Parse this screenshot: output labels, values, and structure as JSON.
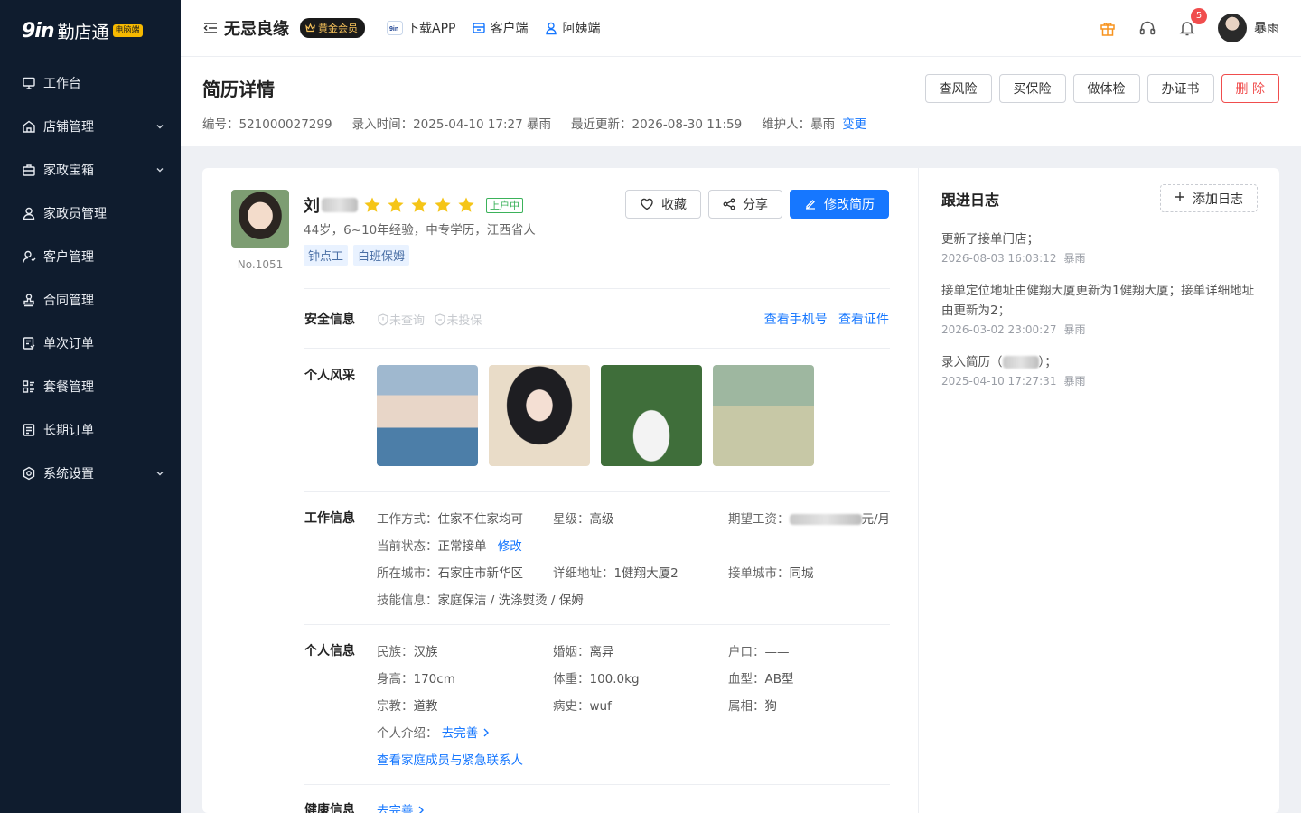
{
  "brand": {
    "mark": "9in",
    "name": "勤店通",
    "badge": "电脑端"
  },
  "sidebar": {
    "items": [
      {
        "label": "工作台",
        "icon": "monitor-icon",
        "expandable": false
      },
      {
        "label": "店铺管理",
        "icon": "store-icon",
        "expandable": true
      },
      {
        "label": "家政宝箱",
        "icon": "toolbox-icon",
        "expandable": true
      },
      {
        "label": "家政员管理",
        "icon": "worker-icon",
        "expandable": false
      },
      {
        "label": "客户管理",
        "icon": "customer-icon",
        "expandable": false
      },
      {
        "label": "合同管理",
        "icon": "stamp-icon",
        "expandable": false
      },
      {
        "label": "单次订单",
        "icon": "order-icon",
        "expandable": false
      },
      {
        "label": "套餐管理",
        "icon": "package-icon",
        "expandable": false
      },
      {
        "label": "长期订单",
        "icon": "long-order-icon",
        "expandable": false
      },
      {
        "label": "系统设置",
        "icon": "settings-icon",
        "expandable": true
      }
    ]
  },
  "header": {
    "shop_name": "无忌良缘",
    "member_badge": "黄金会员",
    "links": [
      {
        "label": "下载APP",
        "icon": "app-icon"
      },
      {
        "label": "客户端",
        "icon": "client-icon"
      },
      {
        "label": "阿姨端",
        "icon": "nanny-icon"
      }
    ],
    "notification_count": "5",
    "user_name": "暴雨"
  },
  "titlebar": {
    "title": "简历详情",
    "id_label": "编号：",
    "id_value": "521000027299",
    "entry_label": "录入时间：",
    "entry_value": "2025-04-10 17:27 暴雨",
    "updated_label": "最近更新：",
    "updated_value": "2026-08-30 11:59",
    "maintainer_label": "维护人：",
    "maintainer_value": "暴雨",
    "change_link": "变更",
    "actions": [
      "查风险",
      "买保险",
      "做体检",
      "办证书",
      "删 除"
    ]
  },
  "profile": {
    "surname": "刘",
    "stars": 5,
    "status": "上户中",
    "summary": "44岁，6~10年经验，中专学历，江西省人",
    "tags": [
      "钟点工",
      "白班保姆"
    ],
    "number": "No.1051",
    "actions": {
      "favorite": "收藏",
      "share": "分享",
      "edit": "修改简历"
    }
  },
  "safety": {
    "label": "安全信息",
    "not_checked": "未查询",
    "not_insured": "未投保",
    "view_phone": "查看手机号",
    "view_cert": "查看证件"
  },
  "gallery": {
    "label": "个人风采"
  },
  "work": {
    "label": "工作信息",
    "mode_label": "工作方式：",
    "mode_value": "住家不住家均可",
    "level_label": "星级：",
    "level_value": "高级",
    "salary_label": "期望工资：",
    "salary_suffix": "元/月",
    "state_label": "当前状态：",
    "state_value": "正常接单",
    "state_edit": "修改",
    "city_label": "所在城市：",
    "city_value": "石家庄市新华区",
    "address_label": "详细地址：",
    "address_value": "1健翔大厦2",
    "order_city_label": "接单城市：",
    "order_city_value": "同城",
    "skills_label": "技能信息：",
    "skills_value": "家庭保洁 / 洗涤熨烫 / 保姆"
  },
  "personal": {
    "label": "个人信息",
    "ethnicity_label": "民族：",
    "ethnicity_value": "汉族",
    "marriage_label": "婚姻：",
    "marriage_value": "离异",
    "hukou_label": "户口：",
    "hukou_value": "——",
    "height_label": "身高：",
    "height_value": "170cm",
    "weight_label": "体重：",
    "weight_value": "100.0kg",
    "blood_label": "血型：",
    "blood_value": "AB型",
    "religion_label": "宗教：",
    "religion_value": "道教",
    "illness_label": "病史：",
    "illness_value": "wuf",
    "zodiac_label": "属相：",
    "zodiac_value": "狗",
    "intro_label": "个人介绍：",
    "intro_link": "去完善",
    "family_link": "查看家庭成员与紧急联系人"
  },
  "health": {
    "label": "健康信息",
    "link": "去完善"
  },
  "log": {
    "title": "跟进日志",
    "add_button": "添加日志",
    "entries": [
      {
        "text": "更新了接单门店；",
        "time": "2026-08-03 16:03:12",
        "user": "暴雨"
      },
      {
        "text": "接单定位地址由健翔大厦更新为1健翔大厦；接单详细地址由更新为2；",
        "time": "2026-03-02 23:00:27",
        "user": "暴雨"
      },
      {
        "text_prefix": "录入简历（",
        "text_suffix": "）；",
        "time": "2025-04-10 17:27:31",
        "user": "暴雨"
      }
    ]
  },
  "colors": {
    "sidebar_bg": "#0f1c2e",
    "accent": "#1677ff",
    "danger": "#f04d4d",
    "star": "#f5c518",
    "success": "#3bb25a"
  }
}
